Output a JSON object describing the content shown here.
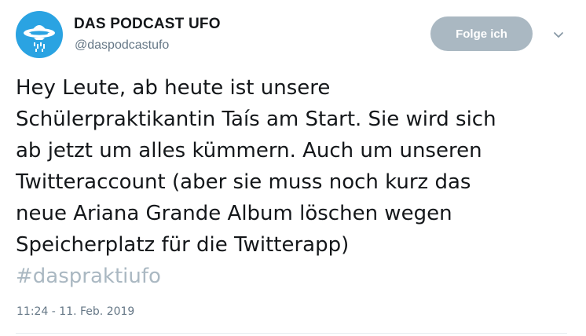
{
  "author": {
    "display_name": "DAS PODCAST UFO",
    "handle": "@daspodcastufo",
    "avatar_icon": "ufo-icon",
    "avatar_color": "#2aa3e2"
  },
  "follow_button": {
    "label": "Folge ich",
    "color": "#aab8c2"
  },
  "menu_icon": "chevron-down-icon",
  "tweet": {
    "lines": [
      "Hey Leute, ab heute ist unsere",
      "Schülerpraktikantin Taís am Start. Sie wird sich",
      "ab jetzt um alles kümmern. Auch um unseren",
      "Twitteraccount (aber sie muss noch kurz das",
      "neue Ariana Grande Album löschen wegen",
      "Speicherplatz für die Twitterapp)"
    ],
    "hashtag": "#daspraktiufo",
    "hashtag_color": "#aab8c2",
    "timestamp": "11:24 - 11. Feb. 2019"
  }
}
